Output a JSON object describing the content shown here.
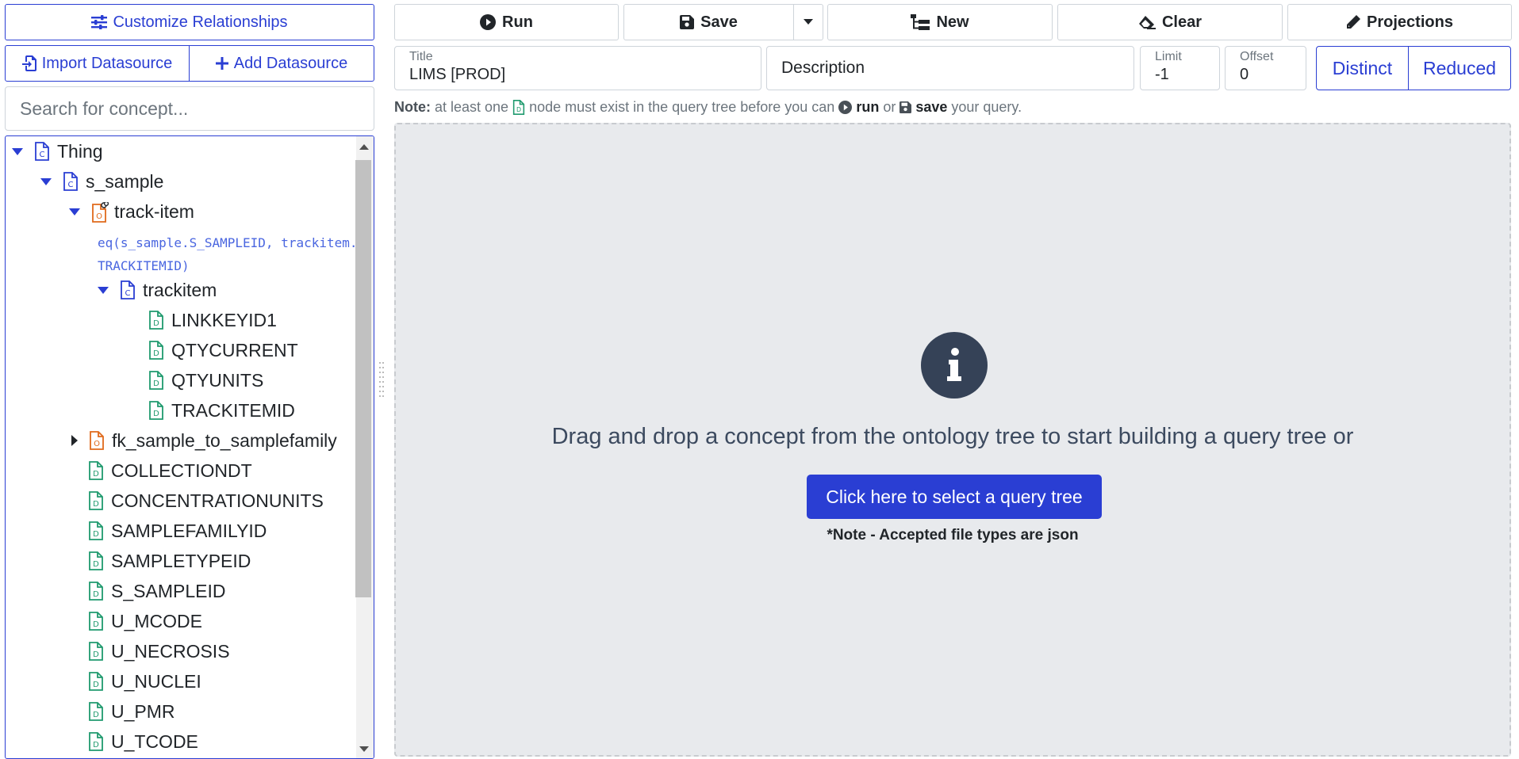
{
  "sidebar": {
    "customize_label": "Customize Relationships",
    "import_label": "Import Datasource",
    "add_label": "Add Datasource",
    "search_placeholder": "Search for concept...",
    "tree": {
      "root": "Thing",
      "s_sample": "s_sample",
      "track_item": "track-item",
      "track_item_expr": "eq(s_sample.S_SAMPLEID, trackitem.TRACKITEMID)",
      "trackitem": "trackitem",
      "trackitem_fields": [
        "LINKKEYID1",
        "QTYCURRENT",
        "QTYUNITS",
        "TRACKITEMID"
      ],
      "fk_relation": "fk_sample_to_samplefamily",
      "sample_fields": [
        "COLLECTIONDT",
        "CONCENTRATIONUNITS",
        "SAMPLEFAMILYID",
        "SAMPLETYPEID",
        "S_SAMPLEID",
        "U_MCODE",
        "U_NECROSIS",
        "U_NUCLEI",
        "U_PMR",
        "U_TCODE"
      ],
      "class_letter": "C",
      "object_letter": "O",
      "datatype_letter": "D"
    }
  },
  "toolbar": {
    "run_label": "Run",
    "save_label": "Save",
    "new_label": "New",
    "clear_label": "Clear",
    "projections_label": "Projections"
  },
  "query": {
    "title_label": "Title",
    "title_value": "LIMS [PROD]",
    "description_placeholder": "Description",
    "limit_label": "Limit",
    "limit_value": "-1",
    "offset_label": "Offset",
    "offset_value": "0",
    "distinct_label": "Distinct",
    "reduced_label": "Reduced"
  },
  "note": {
    "prefix": "Note:",
    "part1": "at least one",
    "part2": "node must exist in the query tree before you can",
    "run_word": "run",
    "or_word": "or",
    "save_word": "save",
    "part3": "your query."
  },
  "drop_area": {
    "message": "Drag and drop a concept from the ontology tree to start building a query tree or",
    "button_label": "Click here to select a query tree",
    "accepted_note": "*Note - Accepted file types are json"
  },
  "colors": {
    "primary": "#2a3ed3",
    "class_icon": "#2a3ed3",
    "object_icon": "#e06a1b",
    "datatype_icon": "#1f9a6e",
    "drop_bg": "#e8eaed",
    "info_circle": "#354257"
  }
}
